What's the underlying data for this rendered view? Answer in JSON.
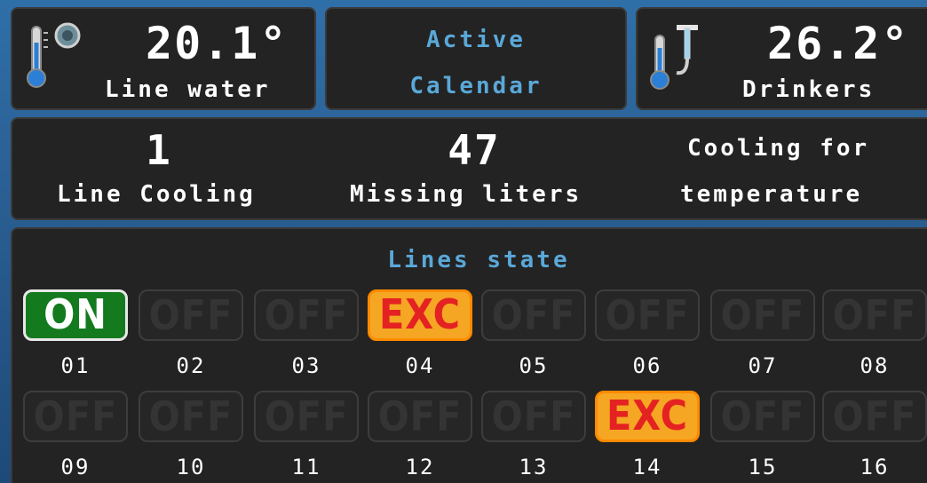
{
  "header": {
    "line_water": {
      "value": "20.1°",
      "label": "Line water",
      "icon": "thermometer-water-icon"
    },
    "calendar": {
      "line1": "Active",
      "line2": "Calendar"
    },
    "drinkers": {
      "value": "26.2°",
      "label": "Drinkers",
      "icon": "thermometer-drinker-icon"
    }
  },
  "status": {
    "line_cooling": {
      "value": "1",
      "label": "Line Cooling"
    },
    "missing_liters": {
      "value": "47",
      "label": "Missing liters"
    },
    "mode": {
      "line1": "Cooling for",
      "line2": "temperature"
    }
  },
  "lines": {
    "title": "Lines state",
    "row1": [
      {
        "num": "01",
        "state": "ON"
      },
      {
        "num": "02",
        "state": "OFF"
      },
      {
        "num": "03",
        "state": "OFF"
      },
      {
        "num": "04",
        "state": "EXC"
      },
      {
        "num": "05",
        "state": "OFF"
      },
      {
        "num": "06",
        "state": "OFF"
      },
      {
        "num": "07",
        "state": "OFF"
      },
      {
        "num": "08",
        "state": "OFF"
      }
    ],
    "row2": [
      {
        "num": "09",
        "state": "OFF"
      },
      {
        "num": "10",
        "state": "OFF"
      },
      {
        "num": "11",
        "state": "OFF"
      },
      {
        "num": "12",
        "state": "OFF"
      },
      {
        "num": "13",
        "state": "OFF"
      },
      {
        "num": "14",
        "state": "EXC"
      },
      {
        "num": "15",
        "state": "OFF"
      },
      {
        "num": "16",
        "state": "OFF"
      }
    ]
  },
  "colors": {
    "on": "#137a1e",
    "exc_bg": "#f5a623",
    "exc_text": "#e42222",
    "accent_blue": "#5aa8d8",
    "panel": "#232323"
  }
}
